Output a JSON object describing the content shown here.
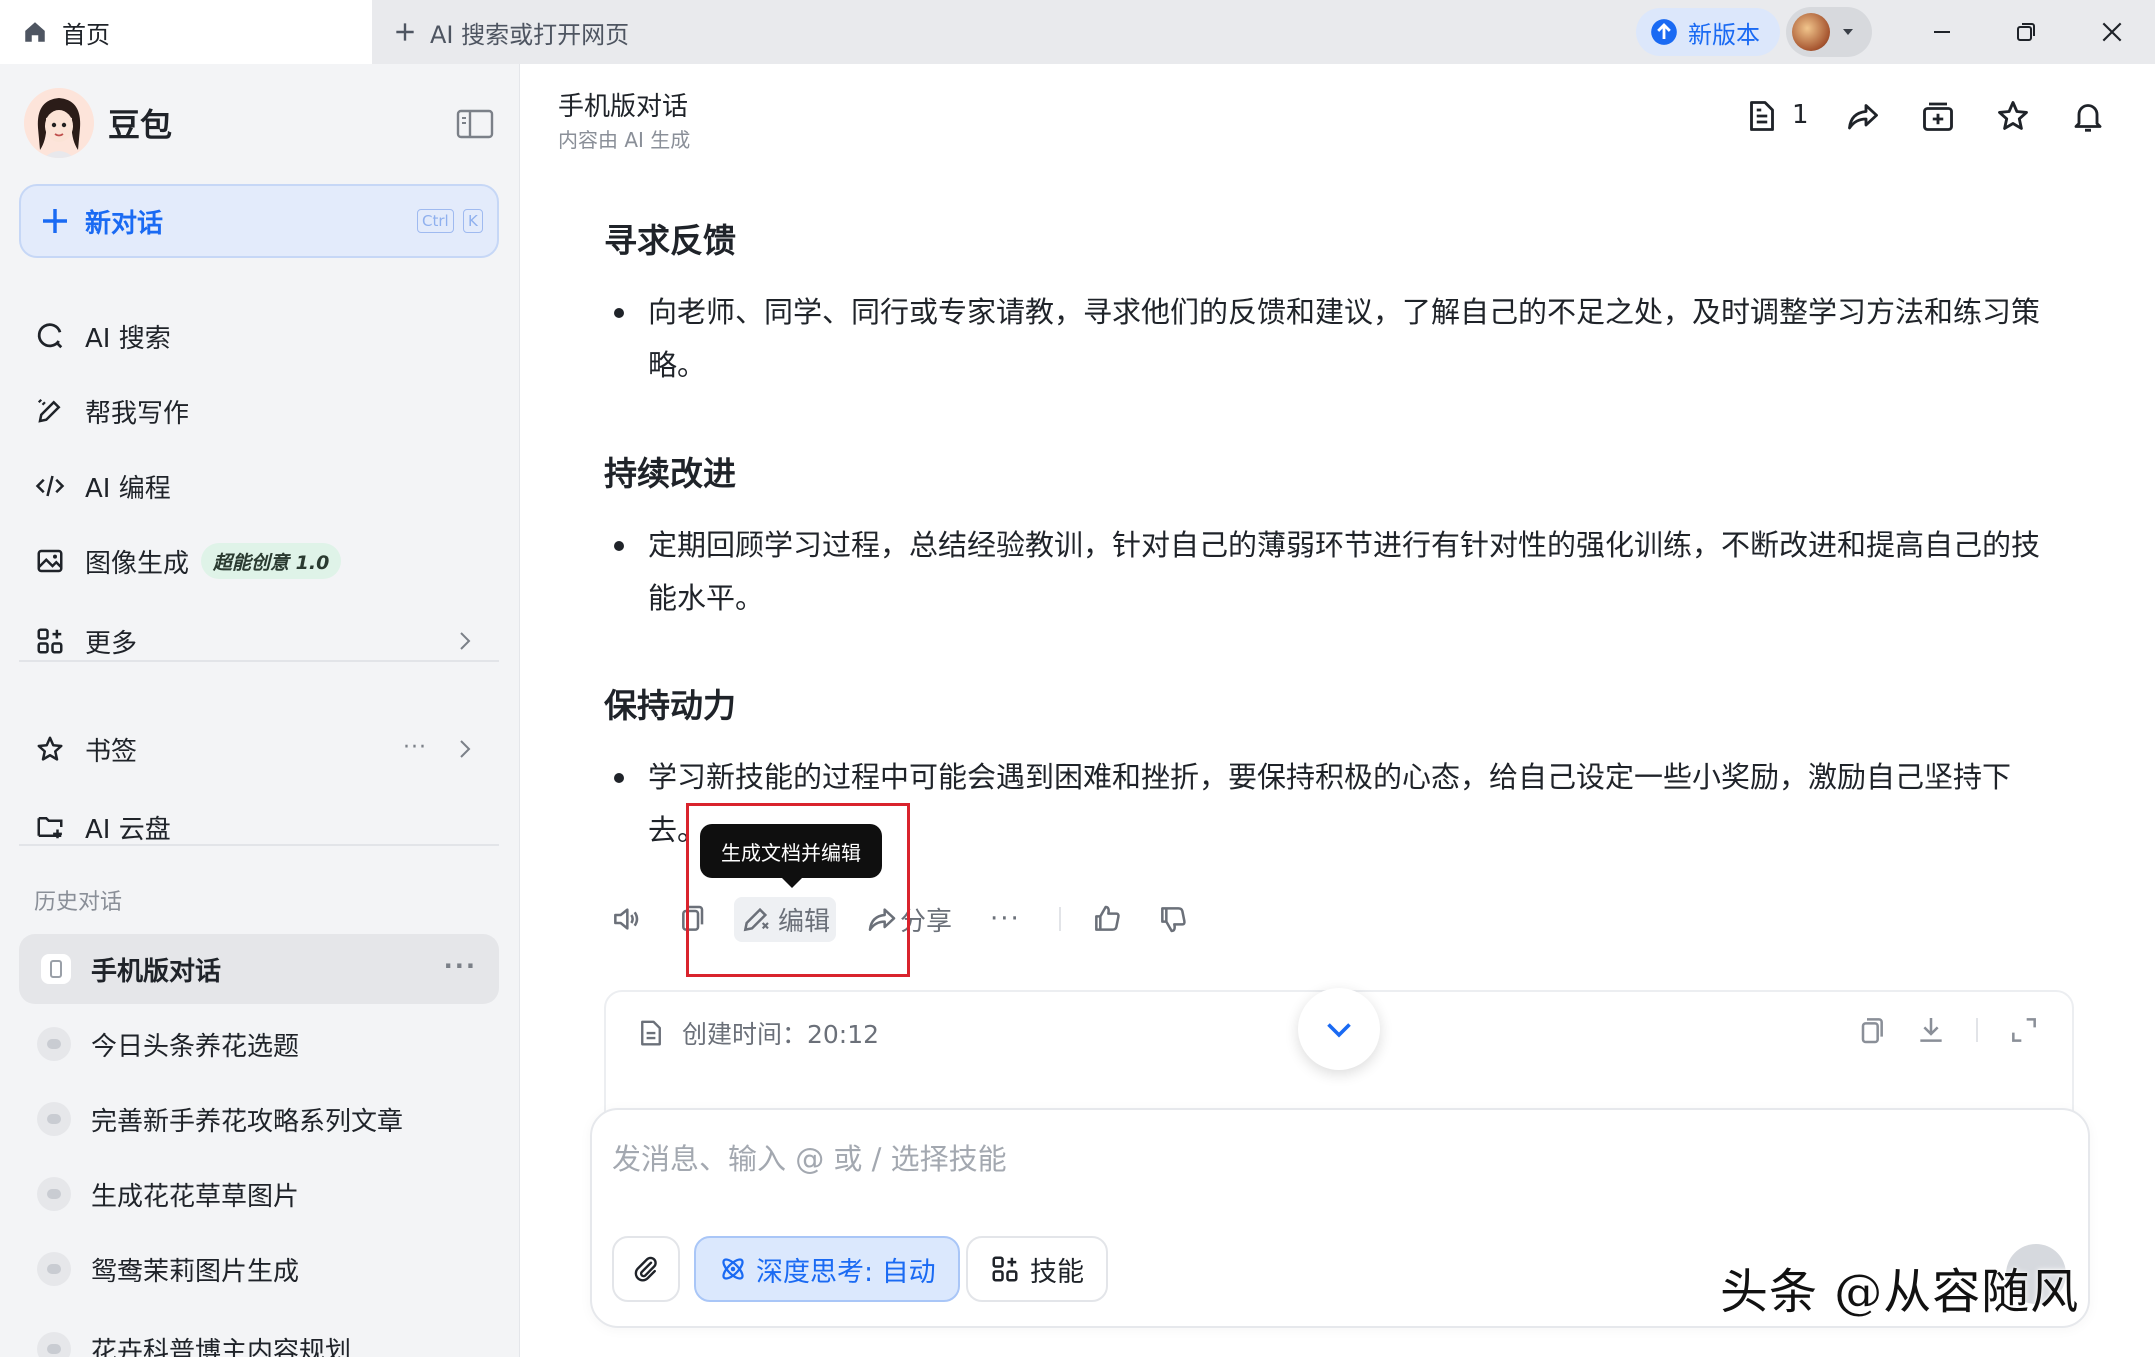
{
  "titlebar": {
    "home_tab": "首页",
    "new_tab": "AI 搜索或打开网页",
    "new_version": "新版本"
  },
  "sidebar": {
    "brand": "豆包",
    "new_chat": {
      "label": "新对话",
      "kbd_ctrl": "Ctrl",
      "kbd_k": "K"
    },
    "nav": [
      {
        "label": "AI 搜索",
        "icon": "ai-search-icon"
      },
      {
        "label": "帮我写作",
        "icon": "pen-icon"
      },
      {
        "label": "AI 编程",
        "icon": "code-icon"
      },
      {
        "label": "图像生成",
        "icon": "image-icon",
        "badge": "超能创意 1.0"
      },
      {
        "label": "更多",
        "icon": "grid-icon"
      }
    ],
    "bookmarks": "书签",
    "cloud": "AI 云盘",
    "history_title": "历史对话",
    "history": [
      "手机版对话",
      "今日头条养花选题",
      "完善新手养花攻略系列文章",
      "生成花花草草图片",
      "鸳鸯茉莉图片生成",
      "花卉科普博主内容规划"
    ]
  },
  "header": {
    "title": "手机版对话",
    "subtitle": "内容由 AI 生成",
    "doc_count": "1"
  },
  "article": [
    {
      "heading": "寻求反馈",
      "text": "向老师、同学、同行或专家请教，寻求他们的反馈和建议，了解自己的不足之处，及时调整学习方法和练习策略。"
    },
    {
      "heading": "持续改进",
      "text": "定期回顾学习过程，总结经验教训，针对自己的薄弱环节进行有针对性的强化训练，不断改进和提高自己的技能水平。"
    },
    {
      "heading": "保持动力",
      "text": "学习新技能的过程中可能会遇到困难和挫折，要保持积极的心态，给自己设定一些小奖励，激励自己坚持下去。"
    }
  ],
  "actions": {
    "edit": "编辑",
    "share": "分享",
    "tooltip": "生成文档并编辑"
  },
  "doc_card": {
    "created": "创建时间：20:12"
  },
  "composer": {
    "placeholder": "发消息、输入 @ 或 / 选择技能",
    "deep_think": "深度思考: 自动",
    "skills": "技能"
  },
  "watermark": "头条 @从容随风",
  "colors": {
    "accent": "#1a6af3",
    "highlight": "#d9232d"
  }
}
